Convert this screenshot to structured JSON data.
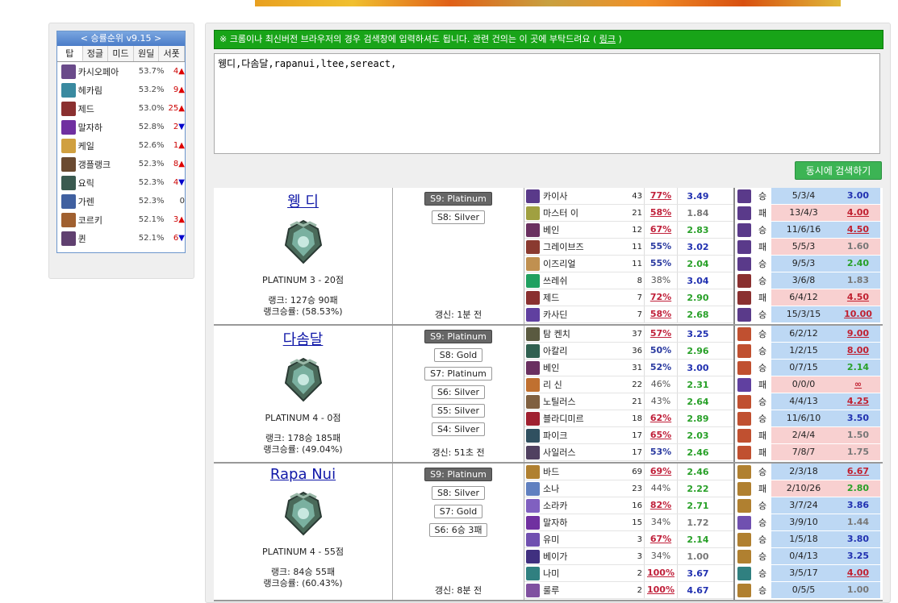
{
  "colors": {
    "notice_bg": "#18a418",
    "search_button": "#3cb454",
    "win_bg": "#bdd8f4",
    "loss_bg": "#f8d0d0",
    "accent_blue": "#1018a8"
  },
  "winrank": {
    "title": "< 승률순위 v9.15 >",
    "tabs": [
      "탑",
      "정글",
      "미드",
      "원딜",
      "서폿"
    ],
    "rows": [
      {
        "champ": "카시오페아",
        "pct": "53.7%",
        "chg": "4",
        "dir": "up",
        "color": "#6a4a8a"
      },
      {
        "champ": "헤카림",
        "pct": "53.2%",
        "chg": "9",
        "dir": "up",
        "color": "#3a8aa0"
      },
      {
        "champ": "제드",
        "pct": "53.0%",
        "chg": "25",
        "dir": "up",
        "color": "#8a3030"
      },
      {
        "champ": "말자하",
        "pct": "52.8%",
        "chg": "2",
        "dir": "down",
        "color": "#7030a0"
      },
      {
        "champ": "케일",
        "pct": "52.6%",
        "chg": "1",
        "dir": "up",
        "color": "#d0a040"
      },
      {
        "champ": "갱플랭크",
        "pct": "52.3%",
        "chg": "8",
        "dir": "up",
        "color": "#6a4a30"
      },
      {
        "champ": "요릭",
        "pct": "52.3%",
        "chg": "4",
        "dir": "down",
        "color": "#3a5a50"
      },
      {
        "champ": "가렌",
        "pct": "52.3%",
        "chg": "0",
        "dir": "none",
        "color": "#4060a0"
      },
      {
        "champ": "코르키",
        "pct": "52.1%",
        "chg": "3",
        "dir": "up",
        "color": "#a06030"
      },
      {
        "champ": "퀸",
        "pct": "52.1%",
        "chg": "6",
        "dir": "down",
        "color": "#604070"
      }
    ]
  },
  "notice": {
    "text": "※ 크롬이나 최신버전 브라우저의 경우 검색창에 입력하셔도 됩니다. 관련 건의는 이 곳에 부탁드려요 (",
    "link": "링크",
    "end": ")"
  },
  "search": {
    "value": "웽디,다솜달,rapanui,ltee,sereact,",
    "button": "동시에 검색하기"
  },
  "players": [
    {
      "name": "웽 디",
      "tier": "PLATINUM 3 - 20점",
      "record": "랭크: 127승 90패",
      "winrate": "랭크승률: (58.53%)",
      "updated": "갱신: 1분 전",
      "badges": [
        {
          "t": "S9: Platinum",
          "cur": true
        },
        {
          "t": "S8: Silver",
          "cur": false
        }
      ],
      "champs": [
        {
          "n": "카이사",
          "g": "43",
          "wr": "77%",
          "k": "3.49",
          "c": "#5a3a8a"
        },
        {
          "n": "마스터 이",
          "g": "21",
          "wr": "58%",
          "k": "1.84",
          "c": "#a0a040"
        },
        {
          "n": "베인",
          "g": "12",
          "wr": "67%",
          "k": "2.83",
          "c": "#6a3060"
        },
        {
          "n": "그레이브즈",
          "g": "11",
          "wr": "55%",
          "k": "3.02",
          "c": "#8a3a30"
        },
        {
          "n": "이즈리얼",
          "g": "11",
          "wr": "55%",
          "k": "2.04",
          "c": "#c09050"
        },
        {
          "n": "쓰레쉬",
          "g": "8",
          "wr": "38%",
          "k": "3.04",
          "c": "#20a060"
        },
        {
          "n": "제드",
          "g": "7",
          "wr": "72%",
          "k": "2.90",
          "c": "#8a3030"
        },
        {
          "n": "카사딘",
          "g": "7",
          "wr": "58%",
          "k": "2.68",
          "c": "#6040a0"
        }
      ],
      "games": [
        {
          "r": "승",
          "kda": "5/3/4",
          "v": "3.00",
          "c": "#5a3a8a"
        },
        {
          "r": "패",
          "kda": "13/4/3",
          "v": "4.00",
          "c": "#5a3a8a"
        },
        {
          "r": "승",
          "kda": "11/6/16",
          "v": "4.50",
          "c": "#5a3a8a"
        },
        {
          "r": "패",
          "kda": "5/5/3",
          "v": "1.60",
          "c": "#5a3a8a"
        },
        {
          "r": "승",
          "kda": "9/5/3",
          "v": "2.40",
          "c": "#5a3a8a"
        },
        {
          "r": "승",
          "kda": "3/6/8",
          "v": "1.83",
          "c": "#8a3030"
        },
        {
          "r": "패",
          "kda": "6/4/12",
          "v": "4.50",
          "c": "#8a3030"
        },
        {
          "r": "승",
          "kda": "15/3/15",
          "v": "10.00",
          "c": "#5a3a8a"
        }
      ]
    },
    {
      "name": "다솜달",
      "tier": "PLATINUM 4 - 0점",
      "record": "랭크: 178승 185패",
      "winrate": "랭크승률: (49.04%)",
      "updated": "갱신: 51초 전",
      "badges": [
        {
          "t": "S9: Platinum",
          "cur": true
        },
        {
          "t": "S8: Gold",
          "cur": false
        },
        {
          "t": "S7: Platinum",
          "cur": false
        },
        {
          "t": "S6: Silver",
          "cur": false
        },
        {
          "t": "S5: Silver",
          "cur": false
        },
        {
          "t": "S4: Silver",
          "cur": false
        }
      ],
      "champs": [
        {
          "n": "탐 켄치",
          "g": "37",
          "wr": "57%",
          "k": "3.25",
          "c": "#5a5a40"
        },
        {
          "n": "아칼리",
          "g": "36",
          "wr": "50%",
          "k": "2.96",
          "c": "#306050"
        },
        {
          "n": "베인",
          "g": "31",
          "wr": "52%",
          "k": "3.00",
          "c": "#6a3060"
        },
        {
          "n": "리 신",
          "g": "22",
          "wr": "46%",
          "k": "2.31",
          "c": "#c07030"
        },
        {
          "n": "노틸러스",
          "g": "21",
          "wr": "43%",
          "k": "2.64",
          "c": "#806040"
        },
        {
          "n": "블라디미르",
          "g": "18",
          "wr": "62%",
          "k": "2.89",
          "c": "#a02030"
        },
        {
          "n": "파이크",
          "g": "17",
          "wr": "65%",
          "k": "2.03",
          "c": "#305060"
        },
        {
          "n": "사일러스",
          "g": "17",
          "wr": "53%",
          "k": "2.46",
          "c": "#504060"
        }
      ],
      "games": [
        {
          "r": "승",
          "kda": "6/2/12",
          "v": "9.00",
          "c": "#c05030"
        },
        {
          "r": "승",
          "kda": "1/2/15",
          "v": "8.00",
          "c": "#c05030"
        },
        {
          "r": "승",
          "kda": "0/7/15",
          "v": "2.14",
          "c": "#c05030"
        },
        {
          "r": "패",
          "kda": "0/0/0",
          "v": "∞",
          "c": "#6040a0"
        },
        {
          "r": "승",
          "kda": "4/4/13",
          "v": "4.25",
          "c": "#c05030"
        },
        {
          "r": "승",
          "kda": "11/6/10",
          "v": "3.50",
          "c": "#c05030"
        },
        {
          "r": "패",
          "kda": "2/4/4",
          "v": "1.50",
          "c": "#c05030"
        },
        {
          "r": "패",
          "kda": "7/8/7",
          "v": "1.75",
          "c": "#c05030"
        }
      ]
    },
    {
      "name": "Rapa Nui",
      "tier": "PLATINUM 4 - 55점",
      "record": "랭크: 84승 55패",
      "winrate": "랭크승률: (60.43%)",
      "updated": "갱신: 8분 전",
      "badges": [
        {
          "t": "S9: Platinum",
          "cur": true
        },
        {
          "t": "S8: Silver",
          "cur": false
        },
        {
          "t": "S7: Gold",
          "cur": false
        },
        {
          "t": "S6: 6승 3패",
          "cur": false
        }
      ],
      "champs": [
        {
          "n": "바드",
          "g": "69",
          "wr": "69%",
          "k": "2.46",
          "c": "#b08030"
        },
        {
          "n": "소나",
          "g": "23",
          "wr": "44%",
          "k": "2.22",
          "c": "#6080c0"
        },
        {
          "n": "소라카",
          "g": "16",
          "wr": "82%",
          "k": "2.71",
          "c": "#8060c0"
        },
        {
          "n": "말자하",
          "g": "15",
          "wr": "34%",
          "k": "1.72",
          "c": "#7030a0"
        },
        {
          "n": "유미",
          "g": "3",
          "wr": "67%",
          "k": "2.14",
          "c": "#7050b0"
        },
        {
          "n": "베이가",
          "g": "3",
          "wr": "34%",
          "k": "1.00",
          "c": "#403080"
        },
        {
          "n": "나미",
          "g": "2",
          "wr": "100%",
          "k": "3.67",
          "c": "#308080"
        },
        {
          "n": "룰루",
          "g": "2",
          "wr": "100%",
          "k": "4.67",
          "c": "#8050a0"
        }
      ],
      "games": [
        {
          "r": "승",
          "kda": "2/3/18",
          "v": "6.67",
          "c": "#b08030"
        },
        {
          "r": "패",
          "kda": "2/10/26",
          "v": "2.80",
          "c": "#b08030"
        },
        {
          "r": "승",
          "kda": "3/7/24",
          "v": "3.86",
          "c": "#b08030"
        },
        {
          "r": "승",
          "kda": "3/9/10",
          "v": "1.44",
          "c": "#7050b0"
        },
        {
          "r": "승",
          "kda": "1/5/18",
          "v": "3.80",
          "c": "#b08030"
        },
        {
          "r": "승",
          "kda": "0/4/13",
          "v": "3.25",
          "c": "#b08030"
        },
        {
          "r": "승",
          "kda": "3/5/17",
          "v": "4.00",
          "c": "#308080"
        },
        {
          "r": "승",
          "kda": "0/5/5",
          "v": "1.00",
          "c": "#b08030"
        }
      ]
    }
  ]
}
